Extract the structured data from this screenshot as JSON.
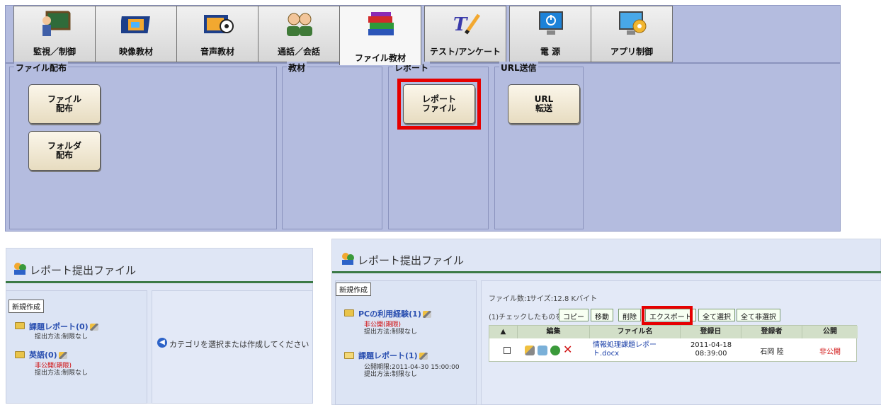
{
  "toolbar": {
    "tabs": [
      {
        "label": "監視／制御",
        "icon": "teacher-blackboard-icon"
      },
      {
        "label": "映像教材",
        "icon": "film-strip-icon"
      },
      {
        "label": "音声教材",
        "icon": "audio-tape-icon"
      },
      {
        "label": "通話／会話",
        "icon": "people-talking-icon"
      },
      {
        "label": "ファイル教材",
        "icon": "books-icon"
      },
      {
        "label": "テスト/アンケート",
        "icon": "test-pen-icon"
      },
      {
        "label": "電 源",
        "icon": "power-monitor-icon"
      },
      {
        "label": "アプリ制御",
        "icon": "app-control-monitor-icon"
      }
    ],
    "active_tab": "ファイル教材",
    "groups": {
      "distribution": {
        "title": "ファイル配布",
        "btn_file": "ファイル\n配布",
        "btn_folder": "フォルダ\n配布"
      },
      "material": {
        "title": "教材"
      },
      "report": {
        "title": "レポート",
        "btn_report": "レポート\nファイル"
      },
      "url": {
        "title": "URL送信",
        "btn_url": "URL\n転送"
      }
    },
    "highlight_color": "#e60000"
  },
  "left_panel": {
    "title": "レポート提出ファイル",
    "new_button": "新規作成",
    "categories": [
      {
        "name": "課題レポート(0)",
        "status": "",
        "method": "提出方法:制限なし"
      },
      {
        "name": "英語(0)",
        "status": "非公開(期限)",
        "method": "提出方法:制限なし"
      }
    ],
    "hint": "カテゴリを選択または作成してください"
  },
  "right_panel": {
    "title": "レポート提出ファイル",
    "new_button": "新規作成",
    "categories": [
      {
        "name": "PCの利用経験(1)",
        "status": "非公開(期限)",
        "method": "提出方法:制限なし"
      },
      {
        "name": "課題レポート(1)",
        "status": "公開期限:2011-04-30 15:00:00",
        "method": "提出方法:制限なし"
      }
    ],
    "file_count": "ファイル数:1",
    "size": "サイズ:12.8 Kバイト",
    "checked_label": "(1)チェックしたものを:",
    "actions": [
      "コピー",
      "移動",
      "削除",
      "エクスポート"
    ],
    "select_all": "全て選択",
    "deselect_all": "全て非選択",
    "columns": [
      "編集",
      "ファイル名",
      "登録日",
      "登録者",
      "公開"
    ],
    "rows": [
      {
        "file_name": "情報処理課題レポート.docx",
        "date": "2011-04-18",
        "time": "08:39:00",
        "owner": "石岡 陸",
        "public": "非公開"
      }
    ]
  }
}
